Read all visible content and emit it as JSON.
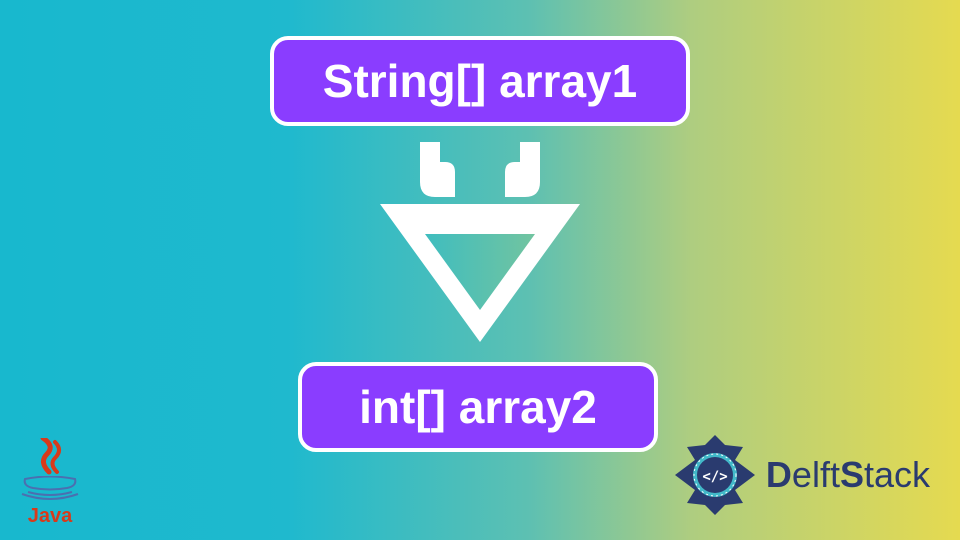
{
  "diagram": {
    "top_box": {
      "text": "String[] array1"
    },
    "bottom_box": {
      "text": "int[] array2"
    },
    "arrow_direction": "down"
  },
  "logos": {
    "java": {
      "label": "Java"
    },
    "delftstack": {
      "text_part1": "D",
      "text_part2": "elft",
      "text_part3": "S",
      "text_part4": "tack"
    }
  },
  "colors": {
    "box_bg": "#8a3dff",
    "box_border": "#ffffff",
    "arrow": "#ffffff",
    "java_accent": "#d73a1b",
    "delft_accent": "#2a3b6f"
  }
}
